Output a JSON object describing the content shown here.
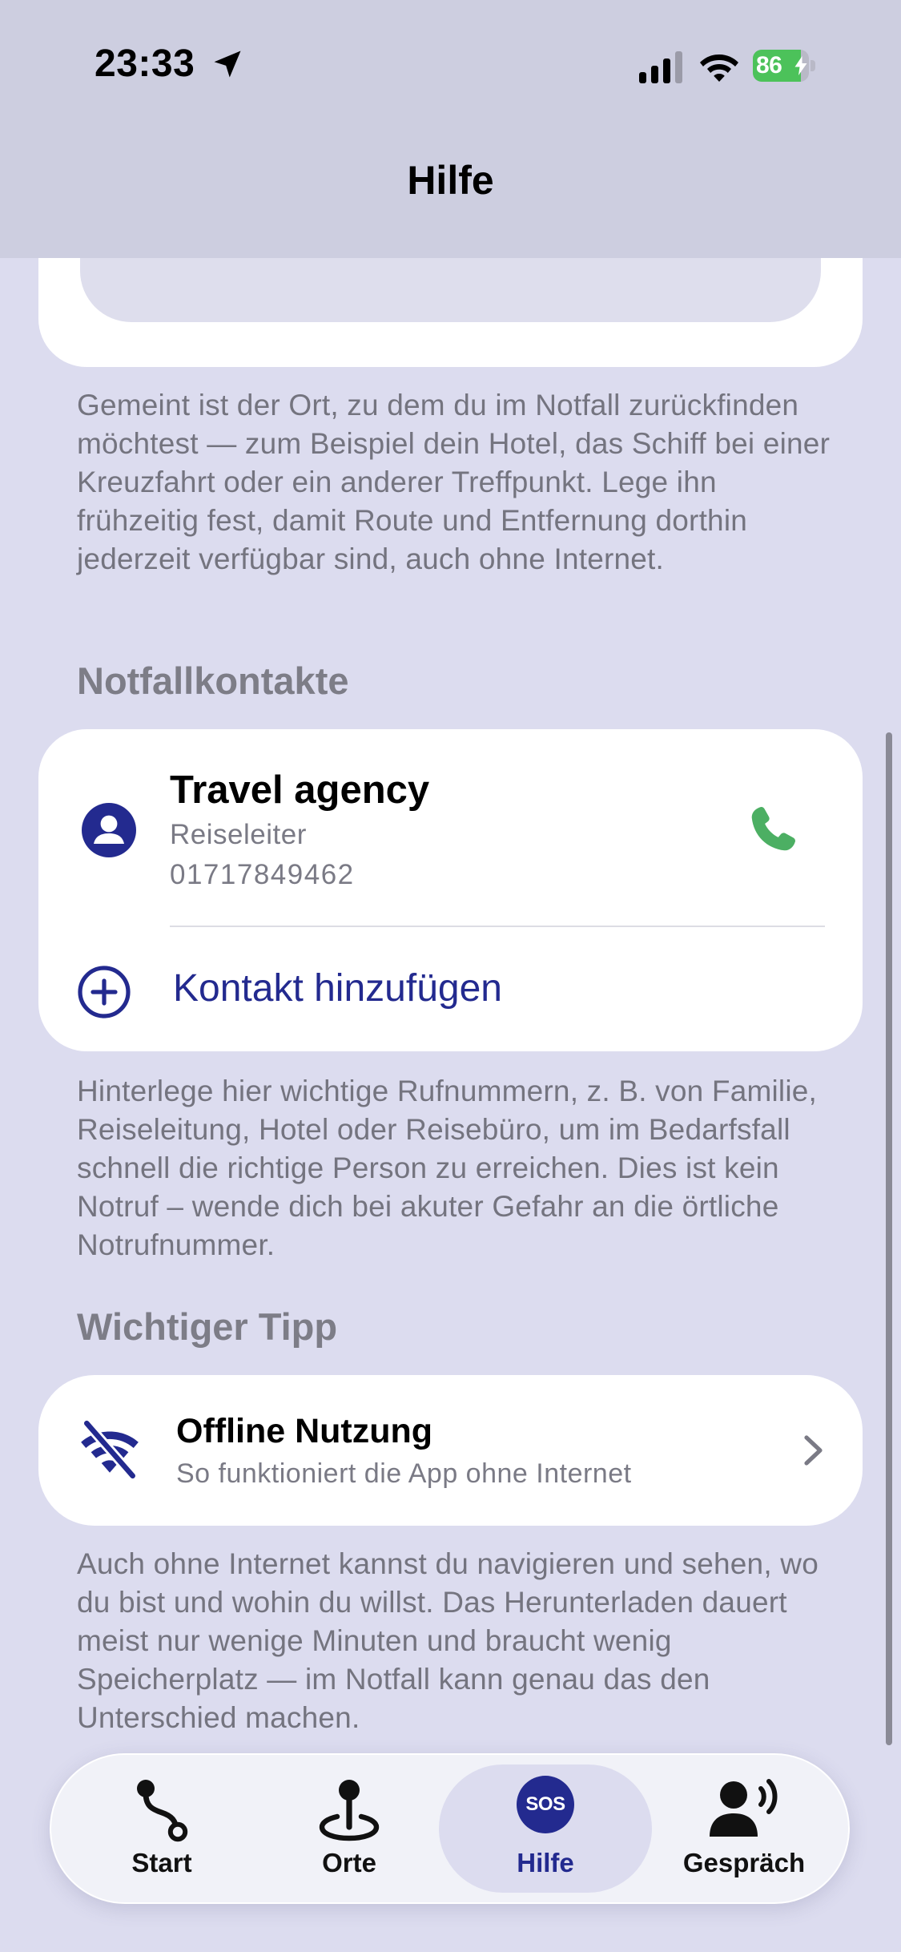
{
  "status_bar": {
    "time": "23:33",
    "battery": "86",
    "battery_level_percent": 86,
    "icons": [
      "location-arrow-icon",
      "signal-icon",
      "wifi-icon",
      "battery-icon"
    ]
  },
  "header": {
    "title": "Hilfe"
  },
  "meeting_point": {
    "description": "Gemeint ist der Ort, zu dem du im Notfall zurückfinden möchtest — zum Beispiel dein Hotel, das Schiff bei einer Kreuzfahrt oder ein anderer Treffpunkt. Lege ihn frühzeitig fest, damit Route und Entfernung dorthin jederzeit verfügbar sind, auch ohne Internet."
  },
  "contacts": {
    "heading": "Notfallkontakte",
    "items": [
      {
        "name": "Travel agency",
        "role": "Reiseleiter",
        "phone": "01717849462"
      }
    ],
    "add_label": "Kontakt hinzufügen",
    "description": "Hinterlege hier wichtige Rufnummern, z. B. von Familie, Reiseleitung, Hotel oder Reisebüro, um im Bedarfsfall schnell die richtige Person zu erreichen. Dies ist kein Notruf – wende dich bei akuter Gefahr an die örtliche Notrufnummer."
  },
  "tip": {
    "heading": "Wichtiger Tipp",
    "title": "Offline Nutzung",
    "subtitle": "So funktioniert die App ohne Internet",
    "description": "Auch ohne Internet kannst du navigieren und sehen, wo du bist und wohin du willst. Das Herunterladen dauert meist nur wenige Minuten und braucht wenig Speicherplatz — im Notfall kann genau das den Unterschied machen."
  },
  "tabbar": {
    "tabs": [
      {
        "label": "Start",
        "icon": "route-icon",
        "active": false
      },
      {
        "label": "Orte",
        "icon": "map-pin-icon",
        "active": false
      },
      {
        "label": "Hilfe",
        "icon": "sos-icon",
        "active": true,
        "badge": "SOS"
      },
      {
        "label": "Gespräch",
        "icon": "speaker-person-icon",
        "active": false
      }
    ]
  },
  "colors": {
    "accent": "#232a8f",
    "background": "#dcdcef",
    "header": "#cdcee0",
    "call_green": "#4caf63",
    "battery_green": "#4cc25a"
  }
}
